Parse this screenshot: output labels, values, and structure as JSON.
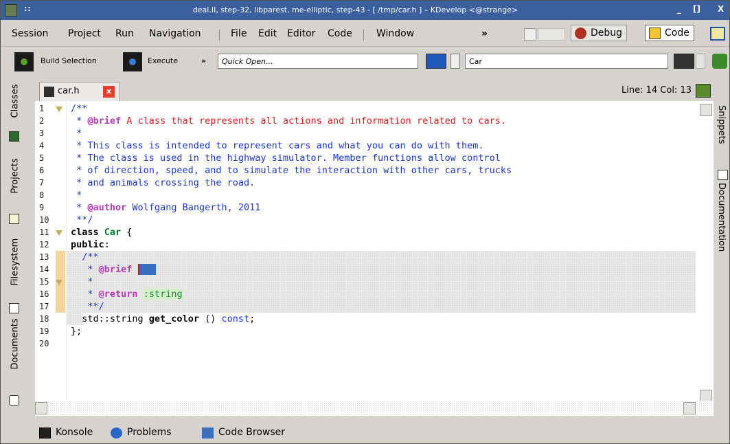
{
  "window": {
    "title": "deal.II, step-32, libparest, me-elliptic, step-43 - [ /tmp/car.h ] – KDevelop <@strange>",
    "dots": "::",
    "min_label": "_",
    "max_label": "[]",
    "close_label": "X"
  },
  "menu": {
    "items": [
      "Session",
      "Project",
      "Run",
      "Navigation",
      "File",
      "Edit",
      "Editor",
      "Code",
      "Window"
    ],
    "more": "»",
    "debug_label": "Debug",
    "code_label": "Code"
  },
  "toolbar": {
    "build_selection": "Build Selection",
    "execute": "Execute",
    "more": "»",
    "quick_open_placeholder": "Quick Open...",
    "context_field": "Car"
  },
  "left_tabs": [
    "Classes",
    "Projects",
    "Filesystem",
    "Documents"
  ],
  "right_tabs": [
    "Snippets",
    "Documentation"
  ],
  "file_tab": {
    "name": "car.h",
    "close": "x"
  },
  "cursor_position": "Line: 14 Col: 13",
  "code": {
    "line_numbers": [
      "1",
      "2",
      "3",
      "4",
      "5",
      "6",
      "7",
      "8",
      "9",
      "10",
      "11",
      "12",
      "13",
      "14",
      "15",
      "16",
      "17",
      "18",
      "19",
      "20"
    ],
    "l1": "/**",
    "l2_star": " * ",
    "l2_tag": "@brief",
    "l2_text": " A class that represents all actions and information related to cars.",
    "l3": " *",
    "l4": " * This class is intended to represent cars and what you can do with them.",
    "l5": " * The class is used in the highway simulator. Member functions allow control",
    "l6": " * of direction, speed, and to simulate the interaction with other cars, trucks",
    "l7": " * and animals crossing the road.",
    "l8": " *",
    "l9_star": " * ",
    "l9_tag": "@author",
    "l9_text": " Wolfgang Bangerth, 2011",
    "l10": " **/",
    "l11_kw": "class",
    "l11_type": "Car",
    "l11_rest": " {",
    "l12_kw": "public",
    "l12_rest": ":",
    "l13": "  /**",
    "l14_star": "   * ",
    "l14_tag": "@brief",
    "l14_sel": "...",
    "l15": "   *",
    "l16_star": "   * ",
    "l16_tag": "@return",
    "l16_sel": ":string",
    "l17": "   **/",
    "l18_a": "  std::string ",
    "l18_fn": "get_color",
    "l18_b": " () ",
    "l18_kw": "const",
    "l18_c": ";",
    "l19": "};"
  },
  "bottom_tabs": [
    "Konsole",
    "Problems",
    "Code Browser"
  ]
}
